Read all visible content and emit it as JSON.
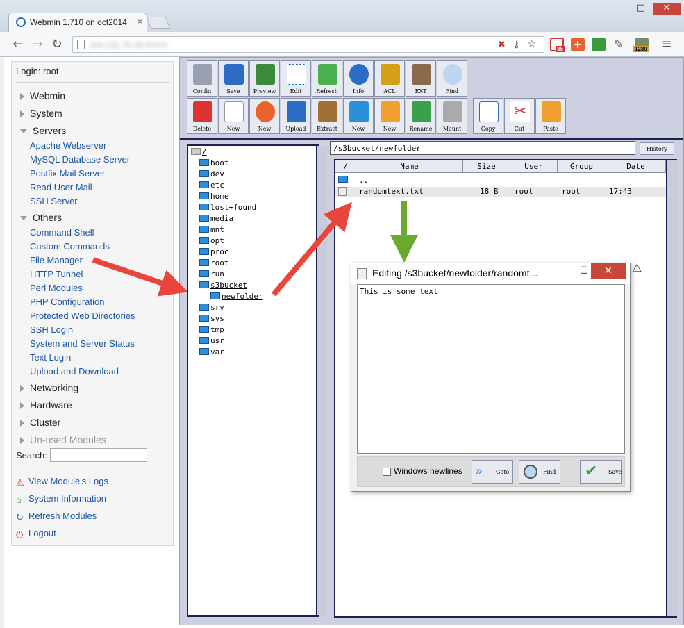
{
  "browser": {
    "tab_title": "Webmin 1.710 on oct2014",
    "tab_close": "×",
    "url_blurred": "104.131.70.25:XXXX",
    "ext_badge_1": "35",
    "ext_badge_2": "1239"
  },
  "sidebar": {
    "login": "Login: root",
    "categories": [
      "Webmin",
      "System",
      "Servers",
      "Others",
      "Networking",
      "Hardware",
      "Cluster",
      "Un-used Modules"
    ],
    "servers_items": [
      "Apache Webserver",
      "MySQL Database Server",
      "Postfix Mail Server",
      "Read User Mail",
      "SSH Server"
    ],
    "others_items": [
      "Command Shell",
      "Custom Commands",
      "File Manager",
      "HTTP Tunnel",
      "Perl Modules",
      "PHP Configuration",
      "Protected Web Directories",
      "SSH Login",
      "System and Server Status",
      "Text Login",
      "Upload and Download"
    ],
    "search_label": "Search:",
    "bottom_links": [
      "View Module's Logs",
      "System Information",
      "Refresh Modules",
      "Logout"
    ]
  },
  "fm": {
    "toolbar_row1": [
      "Config",
      "Save",
      "Preview",
      "Edit",
      "Refresh",
      "Info",
      "ACL",
      "EXT",
      "Find"
    ],
    "toolbar_row2": [
      "Delete",
      "New",
      "New",
      "Upload",
      "Extract",
      "New",
      "New",
      "Rename",
      "Mount",
      "Copy",
      "Cut",
      "Paste"
    ],
    "tree_root": "/",
    "tree": [
      "boot",
      "dev",
      "etc",
      "home",
      "lost+found",
      "media",
      "mnt",
      "opt",
      "proc",
      "root",
      "run",
      "s3bucket",
      "newfolder",
      "srv",
      "sys",
      "tmp",
      "usr",
      "var"
    ],
    "path": "/s3bucket/newfolder",
    "history": "History",
    "columns": [
      "/",
      "Name",
      "Size",
      "User",
      "Group",
      "Date"
    ],
    "rows": [
      {
        "name": "..",
        "size": "",
        "user": "",
        "group": "",
        "date": ""
      },
      {
        "name": "randomtext.txt",
        "size": "18 B",
        "user": "root",
        "group": "root",
        "date": "17:43"
      }
    ]
  },
  "editor": {
    "title": "Editing /s3bucket/newfolder/randomt...",
    "content": "This is some text",
    "checkbox_label": "Windows newlines",
    "goto": "Goto",
    "find": "Find",
    "save": "Save",
    "close": "✕"
  }
}
